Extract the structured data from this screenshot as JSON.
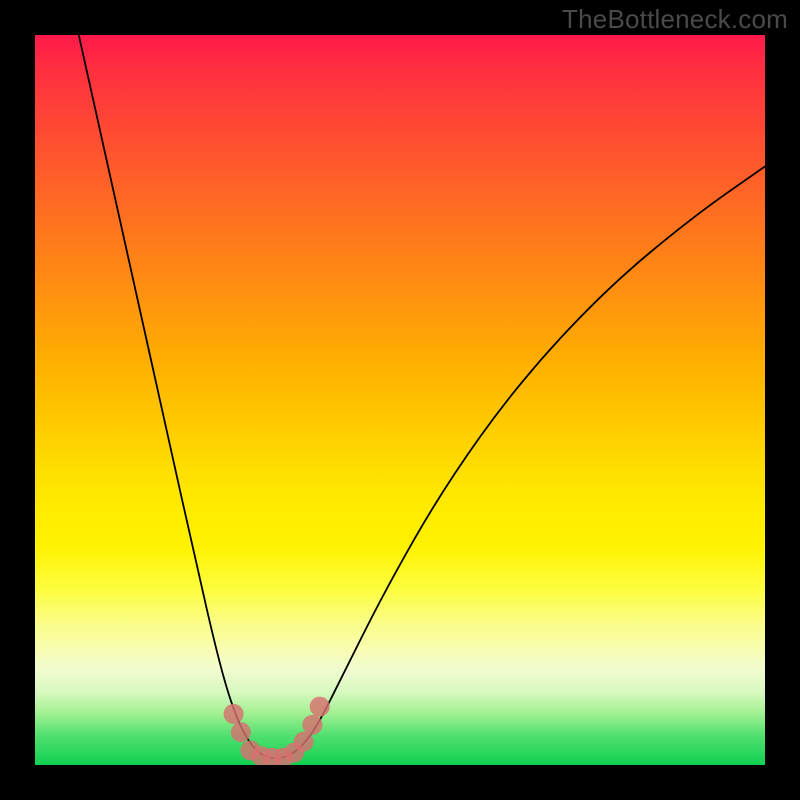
{
  "watermark": "TheBottleneck.com",
  "chart_data": {
    "type": "line",
    "title": "",
    "xlabel": "",
    "ylabel": "",
    "xlim": [
      0,
      100
    ],
    "ylim": [
      0,
      100
    ],
    "series": [
      {
        "name": "curve",
        "points": [
          {
            "x": 6,
            "y": 100
          },
          {
            "x": 10,
            "y": 82
          },
          {
            "x": 14,
            "y": 64
          },
          {
            "x": 18,
            "y": 46
          },
          {
            "x": 22,
            "y": 28
          },
          {
            "x": 25,
            "y": 15
          },
          {
            "x": 27,
            "y": 8
          },
          {
            "x": 29,
            "y": 3.5
          },
          {
            "x": 31,
            "y": 1.3
          },
          {
            "x": 33,
            "y": 0.8
          },
          {
            "x": 35,
            "y": 1.3
          },
          {
            "x": 37,
            "y": 3
          },
          {
            "x": 39,
            "y": 6
          },
          {
            "x": 42,
            "y": 12
          },
          {
            "x": 48,
            "y": 24
          },
          {
            "x": 56,
            "y": 38
          },
          {
            "x": 66,
            "y": 52
          },
          {
            "x": 78,
            "y": 65
          },
          {
            "x": 90,
            "y": 75
          },
          {
            "x": 100,
            "y": 82
          }
        ]
      }
    ],
    "markers": [
      {
        "x": 27.2,
        "y": 7.0
      },
      {
        "x": 28.2,
        "y": 4.5
      },
      {
        "x": 29.5,
        "y": 2.0
      },
      {
        "x": 31.0,
        "y": 1.2
      },
      {
        "x": 32.5,
        "y": 1.0
      },
      {
        "x": 34.0,
        "y": 1.0
      },
      {
        "x": 35.5,
        "y": 1.7
      },
      {
        "x": 36.8,
        "y": 3.2
      },
      {
        "x": 38.0,
        "y": 5.5
      },
      {
        "x": 39.0,
        "y": 8.0
      }
    ],
    "gradient_theme": "bottleneck-rainbow"
  }
}
